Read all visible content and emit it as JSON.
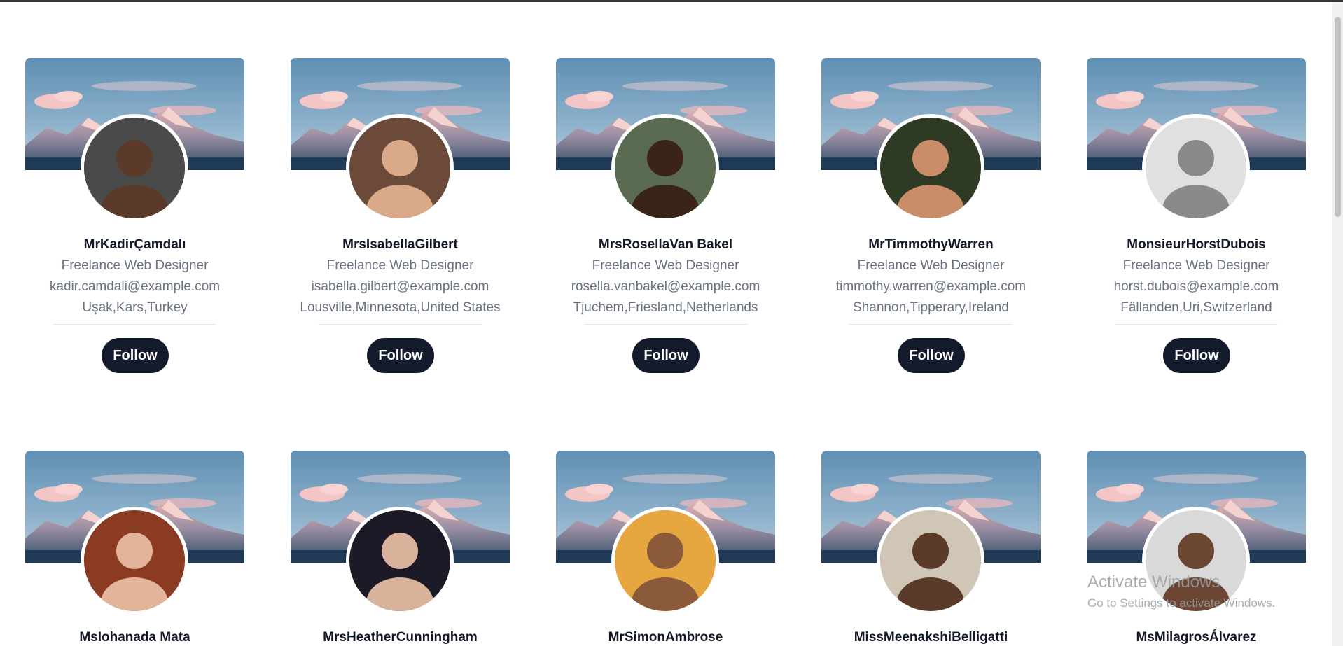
{
  "profiles": [
    {
      "name": "MrKadirÇamdalı",
      "title": "Freelance Web Designer",
      "email": "kadir.camdali@example.com",
      "location": "Uşak,Kars,Turkey",
      "follow_label": "Follow"
    },
    {
      "name": "MrsIsabellaGilbert",
      "title": "Freelance Web Designer",
      "email": "isabella.gilbert@example.com",
      "location": "Lousville,Minnesota,United States",
      "follow_label": "Follow"
    },
    {
      "name": "MrsRosellaVan Bakel",
      "title": "Freelance Web Designer",
      "email": "rosella.vanbakel@example.com",
      "location": "Tjuchem,Friesland,Netherlands",
      "follow_label": "Follow"
    },
    {
      "name": "MrTimmothyWarren",
      "title": "Freelance Web Designer",
      "email": "timmothy.warren@example.com",
      "location": "Shannon,Tipperary,Ireland",
      "follow_label": "Follow"
    },
    {
      "name": "MonsieurHorstDubois",
      "title": "Freelance Web Designer",
      "email": "horst.dubois@example.com",
      "location": "Fällanden,Uri,Switzerland",
      "follow_label": "Follow"
    },
    {
      "name": "MsIohanada Mata"
    },
    {
      "name": "MrsHeatherCunningham"
    },
    {
      "name": "MrSimonAmbrose"
    },
    {
      "name": "MissMeenakshiBelligatti"
    },
    {
      "name": "MsMilagrosÁlvarez"
    }
  ],
  "watermark": {
    "line1": "Activate Windows",
    "line2": "Go to Settings to activate Windows."
  },
  "colors": {
    "button": "#141b2d",
    "name": "#111827",
    "muted": "#6b7280",
    "sky_top": "#5f8fb3",
    "mountain": "#3d5a75"
  }
}
